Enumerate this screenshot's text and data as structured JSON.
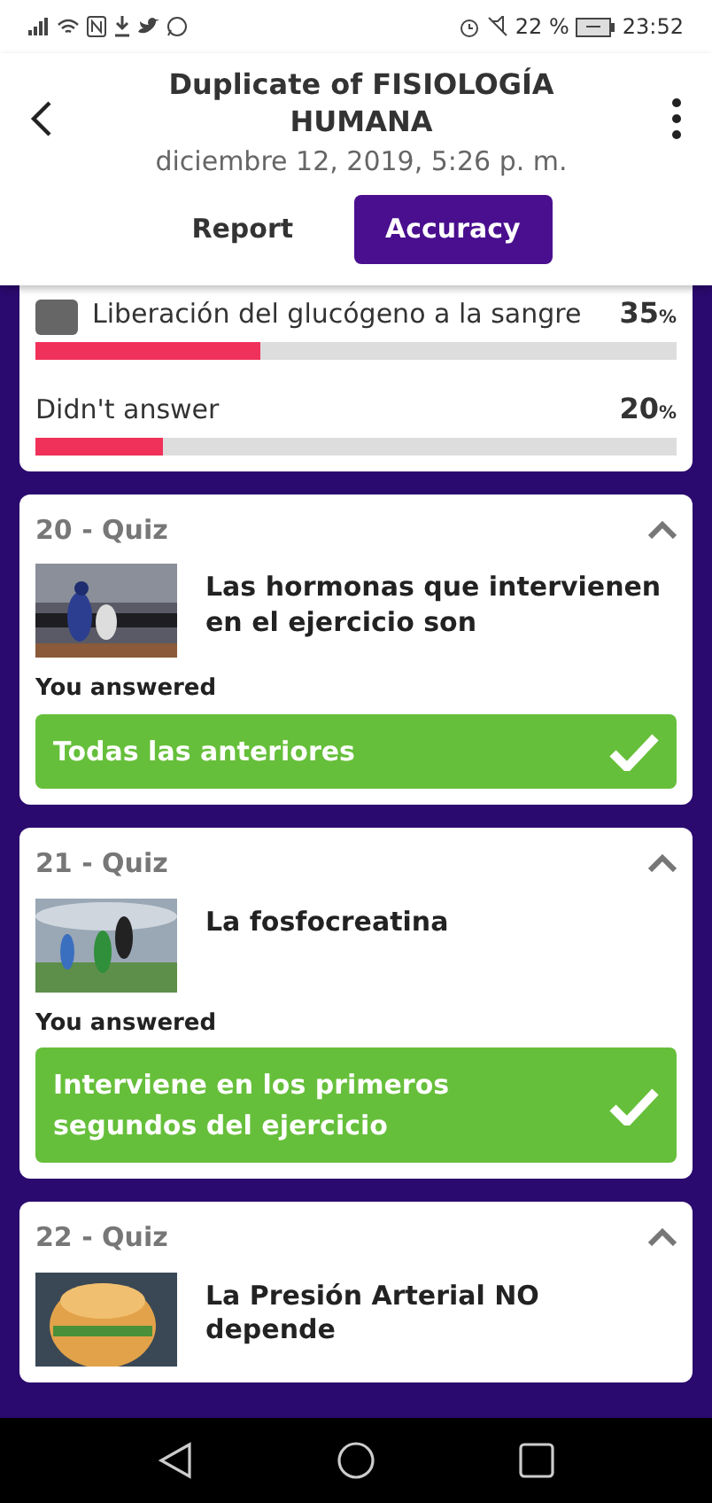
{
  "status_bar": {
    "battery": "22 %",
    "time": "23:52"
  },
  "header": {
    "title": "Duplicate of FISIOLOGÍA HUMANA",
    "date": "diciembre 12, 2019, 5:26 p. m.",
    "tabs": [
      {
        "label": "Report",
        "selected": false
      },
      {
        "label": "Accuracy",
        "selected": true
      }
    ]
  },
  "result_card": {
    "options": [
      {
        "kind": "choice",
        "label": "Liberación del glucógeno a la sangre",
        "value": "35",
        "unit": "%",
        "level": 0.35
      },
      {
        "kind": "plain",
        "label": "Didn't answer",
        "value": "20",
        "unit": "%",
        "level": 0.2
      }
    ]
  },
  "questions": [
    {
      "heading": "20 - Quiz",
      "expanded": true,
      "question": "Las hormonas que intervienen en el ejercicio son",
      "answer_label": "You answered",
      "answer": "Todas las anteriores",
      "correct": true
    },
    {
      "heading": "21 - Quiz",
      "expanded": true,
      "question": "La fosfocreatina",
      "answer_label": "You answered",
      "answer": "Interviene en los primeros segundos del ejercicio",
      "correct": true
    },
    {
      "heading": "22 - Quiz",
      "expanded": true,
      "question": "La Presión Arterial NO depende"
    }
  ]
}
